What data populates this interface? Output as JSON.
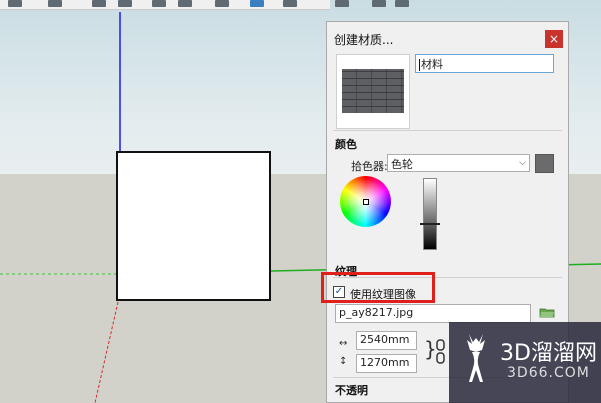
{
  "panel": {
    "title": "创建材质...",
    "close_label": "×",
    "material_name": "材料",
    "color_section": "颜色",
    "picker_label": "拾色器:",
    "picker_value": "色轮",
    "texture_section": "纹理",
    "use_texture_label": "使用纹理图像",
    "use_texture_checked": true,
    "file_name": "p_ay8217.jpg",
    "width_value": "2540mm",
    "height_value": "1270mm",
    "opacity_section": "不透明",
    "color_value": "#6b6b6d"
  },
  "watermark": {
    "line1": "3D溜溜网",
    "line2": "3D66.COM"
  }
}
